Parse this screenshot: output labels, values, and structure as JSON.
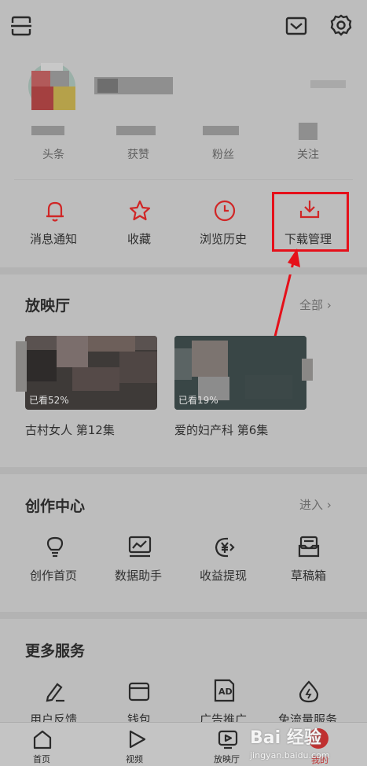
{
  "header": {
    "scan_icon": "scan-icon",
    "mail_icon": "mail-icon",
    "settings_icon": "gear-icon"
  },
  "stats": [
    {
      "label": "头条"
    },
    {
      "label": "获赞"
    },
    {
      "label": "粉丝"
    },
    {
      "label": "关注"
    }
  ],
  "quick_actions": [
    {
      "label": "消息通知",
      "icon": "bell-icon"
    },
    {
      "label": "收藏",
      "icon": "star-icon"
    },
    {
      "label": "浏览历史",
      "icon": "clock-icon"
    },
    {
      "label": "下载管理",
      "icon": "download-icon"
    }
  ],
  "theater": {
    "title": "放映厅",
    "more": "全部 ›",
    "items": [
      {
        "badge": "已看52%",
        "title": "古村女人 第12集"
      },
      {
        "badge": "已看19%",
        "title": "爱的妇产科 第6集"
      }
    ]
  },
  "creator": {
    "title": "创作中心",
    "more": "进入 ›",
    "items": [
      {
        "label": "创作首页",
        "icon": "bulb-icon"
      },
      {
        "label": "数据助手",
        "icon": "chart-icon"
      },
      {
        "label": "收益提现",
        "icon": "yuan-coin-icon"
      },
      {
        "label": "草稿箱",
        "icon": "draft-box-icon"
      }
    ]
  },
  "services": {
    "title": "更多服务",
    "items": [
      {
        "label": "用户反馈",
        "icon": "pen-icon"
      },
      {
        "label": "钱包",
        "icon": "wallet-icon"
      },
      {
        "label": "广告推广",
        "icon": "ad-icon"
      },
      {
        "label": "免流量服务",
        "icon": "drop-icon"
      }
    ]
  },
  "bottom_nav": [
    {
      "label": "首页",
      "icon": "home-icon"
    },
    {
      "label": "视频",
      "icon": "play-icon"
    },
    {
      "label": "放映厅",
      "icon": "tv-play-icon"
    },
    {
      "label": "我的",
      "icon": "profile-icon"
    }
  ],
  "watermark": {
    "text": "Bai 经验",
    "url": "jingyan.baidu.com"
  },
  "colors": {
    "overlay_bg": "#bdbdbd",
    "accent_red": "#d02626",
    "highlight_box": "#e5101a",
    "text_dark": "#2a2a2a",
    "text_muted": "#5f5f5f"
  }
}
